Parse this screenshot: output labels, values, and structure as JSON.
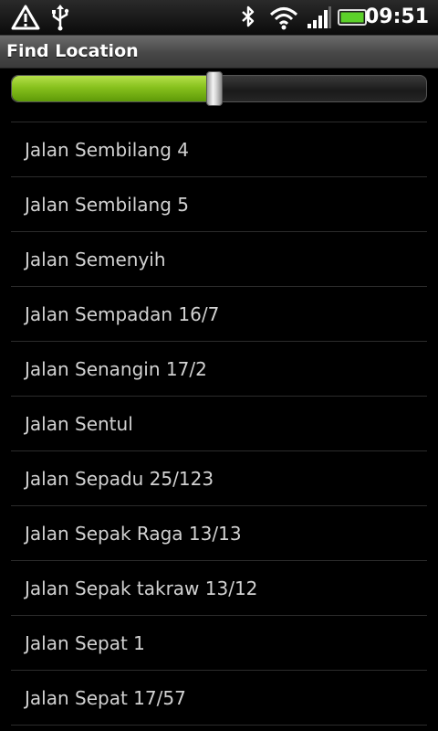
{
  "status_bar": {
    "time": "09:51",
    "icons": [
      "warning-icon",
      "usb-icon",
      "bluetooth-icon",
      "wifi-icon",
      "signal-icon",
      "battery-icon"
    ],
    "battery_color": "#5cd12a"
  },
  "title_bar": {
    "title": "Find Location"
  },
  "slider": {
    "progress_fraction": 0.49,
    "fill_color": "#87c11d"
  },
  "list": {
    "items": [
      {
        "label": "Jalan Sembilang 4"
      },
      {
        "label": "Jalan Sembilang 5"
      },
      {
        "label": "Jalan Semenyih"
      },
      {
        "label": "Jalan Sempadan 16/7"
      },
      {
        "label": "Jalan Senangin 17/2"
      },
      {
        "label": "Jalan Sentul"
      },
      {
        "label": "Jalan Sepadu 25/123"
      },
      {
        "label": "Jalan Sepak Raga 13/13"
      },
      {
        "label": "Jalan Sepak takraw 13/12"
      },
      {
        "label": "Jalan Sepat 1"
      },
      {
        "label": "Jalan Sepat 17/57"
      }
    ]
  }
}
